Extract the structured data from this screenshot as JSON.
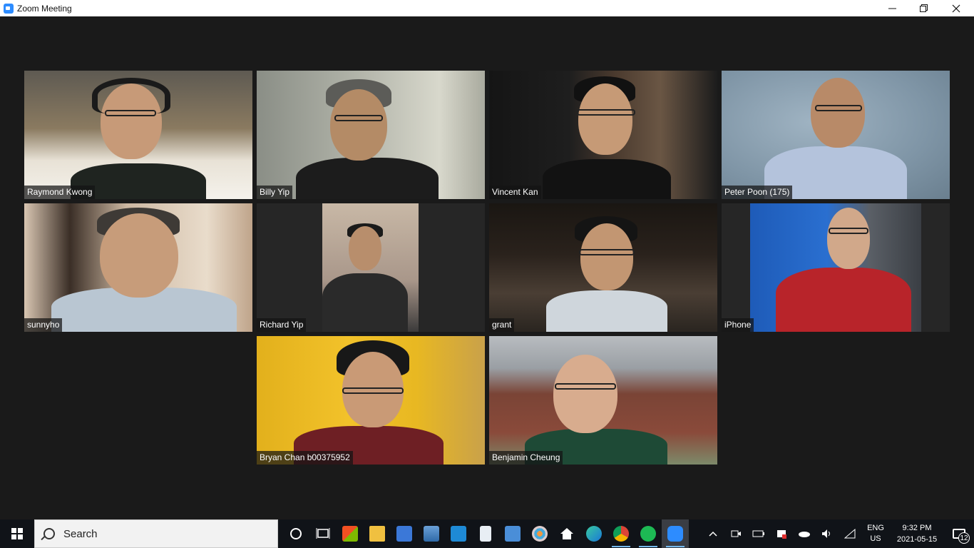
{
  "window": {
    "title": "Zoom Meeting",
    "controls": [
      "minimize",
      "restore",
      "close"
    ]
  },
  "participants": [
    {
      "name": "Raymond Kwong",
      "active": false,
      "background": "snowy-night-street"
    },
    {
      "name": "Billy Yip",
      "active": false,
      "background": "room-with-lamp"
    },
    {
      "name": "Vincent Kan",
      "active": false,
      "background": "bookshelf"
    },
    {
      "name": "Peter Poon (175)",
      "active": false,
      "background": "blue-backdrop"
    },
    {
      "name": "sunnyho",
      "active": false,
      "background": "home-interior"
    },
    {
      "name": "Richard Yip",
      "active": false,
      "background": "ceiling-fan-room"
    },
    {
      "name": "grant",
      "active": true,
      "background": "dark-bar-room"
    },
    {
      "name": "iPhone",
      "active": false,
      "background": "blue-wall-red-sweater"
    },
    {
      "name": "Bryan Chan b00375952",
      "active": false,
      "background": "yellow-wall"
    },
    {
      "name": "Benjamin Cheung",
      "active": false,
      "background": "church-building"
    }
  ],
  "taskbar": {
    "search_label": "Search",
    "pinned_icons": [
      "cortana-icon",
      "task-view-icon",
      "microsoft-store-icon",
      "file-explorer-icon",
      "remote-desktop-icon",
      "photos-icon",
      "mail-icon",
      "document-icon",
      "control-panel-icon",
      "paint-icon",
      "home-icon",
      "edge-icon",
      "chrome-icon",
      "spotify-icon",
      "zoom-icon"
    ],
    "tray": {
      "language_line1": "ENG",
      "language_line2": "US",
      "time": "9:32 PM",
      "date": "2021-05-15",
      "notification_count": "12"
    }
  },
  "colors": {
    "meeting_background": "#1a1a1a",
    "active_speaker_border": "#d8e06a",
    "taskbar_background": "#101318",
    "zoom_blue": "#2d8cff"
  }
}
